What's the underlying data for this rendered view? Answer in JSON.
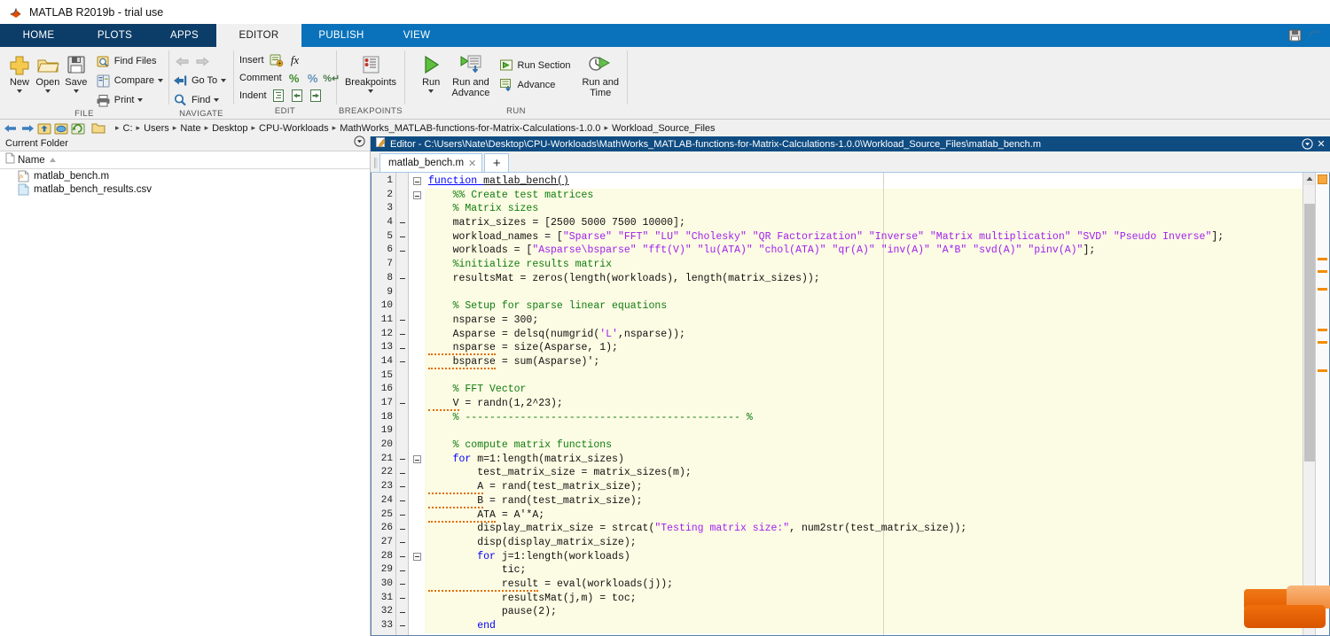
{
  "window": {
    "title": "MATLAB R2019b - trial use",
    "logo_icon": "matlab-logo-icon"
  },
  "ribbon": {
    "tabs": [
      {
        "label": "HOME",
        "active": false
      },
      {
        "label": "PLOTS",
        "active": false
      },
      {
        "label": "APPS",
        "active": false
      },
      {
        "label": "EDITOR",
        "active": true
      },
      {
        "label": "PUBLISH",
        "active": false
      },
      {
        "label": "VIEW",
        "active": false
      }
    ],
    "quick_access": [
      "save-icon",
      "undo-icon"
    ],
    "groups": [
      {
        "name": "FILE",
        "big_buttons": [
          {
            "label": "New",
            "icon": "new-plus-icon",
            "has_caret": true
          },
          {
            "label": "Open",
            "icon": "open-folder-icon",
            "has_caret": true
          },
          {
            "label": "Save",
            "icon": "save-disk-icon",
            "has_caret": true
          }
        ],
        "small_buttons": [
          {
            "label": "Find Files",
            "icon": "find-files-icon",
            "has_caret": false
          },
          {
            "label": "Compare",
            "icon": "compare-icon",
            "has_caret": true
          },
          {
            "label": "Print",
            "icon": "print-icon",
            "has_caret": true
          }
        ]
      },
      {
        "name": "NAVIGATE",
        "arrows": [
          "back-arrow-icon",
          "forward-arrow-icon"
        ],
        "small_buttons": [
          {
            "label": "Go To",
            "icon": "goto-icon",
            "has_caret": true
          },
          {
            "label": "Find",
            "icon": "find-magnifier-icon",
            "has_caret": true
          }
        ]
      },
      {
        "name": "EDIT",
        "rows": [
          {
            "label": "Insert",
            "icons": [
              "insert-icon",
              "fx-function-icon"
            ]
          },
          {
            "label": "Comment",
            "icons": [
              "comment-percent-icon",
              "uncomment-percent-icon",
              "wrap-comment-icon"
            ]
          },
          {
            "label": "Indent",
            "icons": [
              "smart-indent-icon",
              "indent-right-icon",
              "indent-left-icon"
            ]
          }
        ]
      },
      {
        "name": "BREAKPOINTS",
        "big_buttons": [
          {
            "label": "Breakpoints",
            "icon": "breakpoints-icon",
            "has_caret": true
          }
        ]
      },
      {
        "name": "RUN",
        "big_buttons": [
          {
            "label": "Run",
            "icon": "run-play-icon",
            "has_caret": true
          },
          {
            "label": "Run and Advance",
            "icon": "run-advance-icon",
            "has_caret": false
          },
          {
            "label": "Run and Time",
            "icon": "run-time-icon",
            "has_caret": false
          }
        ],
        "small_buttons": [
          {
            "label": "Run Section",
            "icon": "run-section-icon",
            "has_caret": false
          },
          {
            "label": "Advance",
            "icon": "advance-icon",
            "has_caret": false
          }
        ]
      }
    ]
  },
  "addressbar": {
    "nav_icons": [
      "back-arrow-icon",
      "forward-arrow-icon",
      "up-folder-icon",
      "browse-folder-icon",
      "refresh-icon"
    ],
    "folder_icon": "folder-icon",
    "crumbs": [
      "C:",
      "Users",
      "Nate",
      "Desktop",
      "CPU-Workloads",
      "MathWorks_MATLAB-functions-for-Matrix-Calculations-1.0.0",
      "Workload_Source_Files"
    ],
    "separator": "▸"
  },
  "current_folder": {
    "title": "Current Folder",
    "actions_icon": "panel-actions-icon",
    "column_header": {
      "label": "Name",
      "sort_icon": "sort-ascending-icon",
      "file_icon": "file-column-icon"
    },
    "files": [
      {
        "name": "matlab_bench.m",
        "icon": "m-file-icon"
      },
      {
        "name": "matlab_bench_results.csv",
        "icon": "csv-file-icon"
      }
    ]
  },
  "editor": {
    "title": "Editor - C:\\Users\\Nate\\Desktop\\CPU-Workloads\\MathWorks_MATLAB-functions-for-Matrix-Calculations-1.0.0\\Workload_Source_Files\\matlab_bench.m",
    "title_icon": "editor-doc-icon",
    "minimize_icon": "panel-actions-icon",
    "close_icon": "close-icon",
    "tabs": [
      {
        "label": "matlab_bench.m",
        "active": true,
        "close_icon": "close-icon"
      }
    ],
    "new_tab_label": "+",
    "scrollbar": {
      "thumb_top_pct": 4,
      "thumb_height_pct": 56
    },
    "markers": [
      96,
      110,
      130,
      176,
      190,
      222
    ],
    "lines": [
      {
        "n": 1,
        "bp": false,
        "fold": "open",
        "code": [
          {
            "t": "function ",
            "c": "kw-ul"
          },
          {
            "t": "matlab_bench()",
            "c": "ul"
          }
        ]
      },
      {
        "n": 2,
        "bp": false,
        "fold": "open2",
        "code": [
          {
            "t": "    %% Create test matrices",
            "c": "cm"
          }
        ]
      },
      {
        "n": 3,
        "bp": false,
        "fold": "tick",
        "code": [
          {
            "t": "    % Matrix sizes",
            "c": "cm"
          }
        ]
      },
      {
        "n": 4,
        "bp": true,
        "fold": "",
        "code": [
          {
            "t": "    matrix_sizes = [2500 5000 7500 10000];",
            "c": ""
          }
        ]
      },
      {
        "n": 5,
        "bp": true,
        "fold": "",
        "code": [
          {
            "t": "    workload_names = [",
            "c": ""
          },
          {
            "t": "\"Sparse\" \"FFT\" \"LU\" \"Cholesky\" \"QR Factorization\" \"Inverse\" \"Matrix multiplication\" \"SVD\" \"Pseudo Inverse\"",
            "c": "st"
          },
          {
            "t": "];",
            "c": ""
          }
        ]
      },
      {
        "n": 6,
        "bp": true,
        "fold": "",
        "code": [
          {
            "t": "    workloads = [",
            "c": ""
          },
          {
            "t": "\"Asparse\\bsparse\" \"fft(V)\" \"lu(ATA)\" \"chol(ATA)\" \"qr(A)\" \"inv(A)\" \"A*B\" \"svd(A)\" \"pinv(A)\"",
            "c": "st"
          },
          {
            "t": "];",
            "c": ""
          }
        ]
      },
      {
        "n": 7,
        "bp": false,
        "fold": "",
        "code": [
          {
            "t": "    %initialize results matrix",
            "c": "cm"
          }
        ]
      },
      {
        "n": 8,
        "bp": true,
        "fold": "",
        "code": [
          {
            "t": "    resultsMat = zeros(length(workloads), length(matrix_sizes));",
            "c": ""
          }
        ]
      },
      {
        "n": 9,
        "bp": false,
        "fold": "",
        "code": [
          {
            "t": "",
            "c": ""
          }
        ]
      },
      {
        "n": 10,
        "bp": false,
        "fold": "",
        "code": [
          {
            "t": "    % Setup for sparse linear equations",
            "c": "cm"
          }
        ]
      },
      {
        "n": 11,
        "bp": true,
        "fold": "",
        "code": [
          {
            "t": "    nsparse = 300;",
            "c": ""
          }
        ]
      },
      {
        "n": 12,
        "bp": true,
        "fold": "",
        "code": [
          {
            "t": "    Asparse = delsq(numgrid(",
            "c": ""
          },
          {
            "t": "'L'",
            "c": "sq"
          },
          {
            "t": ",nsparse));",
            "c": ""
          }
        ]
      },
      {
        "n": 13,
        "bp": true,
        "fold": "",
        "code": [
          {
            "t": "    nsparse",
            "c": "sqw"
          },
          {
            "t": " = size(Asparse, 1);",
            "c": ""
          }
        ]
      },
      {
        "n": 14,
        "bp": true,
        "fold": "",
        "code": [
          {
            "t": "    bsparse",
            "c": "sqw"
          },
          {
            "t": " = sum(Asparse)';",
            "c": ""
          }
        ]
      },
      {
        "n": 15,
        "bp": false,
        "fold": "",
        "code": [
          {
            "t": "",
            "c": ""
          }
        ]
      },
      {
        "n": 16,
        "bp": false,
        "fold": "",
        "code": [
          {
            "t": "    % FFT Vector",
            "c": "cm"
          }
        ]
      },
      {
        "n": 17,
        "bp": true,
        "fold": "",
        "code": [
          {
            "t": "    V",
            "c": "sqw"
          },
          {
            "t": " = randn(1,2^23);",
            "c": ""
          }
        ]
      },
      {
        "n": 18,
        "bp": false,
        "fold": "",
        "code": [
          {
            "t": "    % --------------------------------------------- %",
            "c": "cm"
          }
        ]
      },
      {
        "n": 19,
        "bp": false,
        "fold": "",
        "code": [
          {
            "t": "",
            "c": ""
          }
        ]
      },
      {
        "n": 20,
        "bp": false,
        "fold": "",
        "code": [
          {
            "t": "    % compute matrix functions",
            "c": "cm"
          }
        ]
      },
      {
        "n": 21,
        "bp": true,
        "fold": "open2",
        "code": [
          {
            "t": "    for",
            "c": "kw"
          },
          {
            "t": " m=1:length(matrix_sizes)",
            "c": ""
          }
        ]
      },
      {
        "n": 22,
        "bp": true,
        "fold": "",
        "code": [
          {
            "t": "        test_matrix_size = matrix_sizes(m);",
            "c": ""
          }
        ]
      },
      {
        "n": 23,
        "bp": true,
        "fold": "",
        "code": [
          {
            "t": "        A",
            "c": "sqw"
          },
          {
            "t": " = rand(test_matrix_size);",
            "c": ""
          }
        ]
      },
      {
        "n": 24,
        "bp": true,
        "fold": "",
        "code": [
          {
            "t": "        B",
            "c": "sqw"
          },
          {
            "t": " = rand(test_matrix_size);",
            "c": ""
          }
        ]
      },
      {
        "n": 25,
        "bp": true,
        "fold": "",
        "code": [
          {
            "t": "        ATA",
            "c": "sqw"
          },
          {
            "t": " = A'*A;",
            "c": ""
          }
        ]
      },
      {
        "n": 26,
        "bp": true,
        "fold": "",
        "code": [
          {
            "t": "        display_matrix_size = strcat(",
            "c": ""
          },
          {
            "t": "\"Testing matrix size:\"",
            "c": "st"
          },
          {
            "t": ", num2str(test_matrix_size));",
            "c": ""
          }
        ]
      },
      {
        "n": 27,
        "bp": true,
        "fold": "",
        "code": [
          {
            "t": "        disp(display_matrix_size);",
            "c": ""
          }
        ]
      },
      {
        "n": 28,
        "bp": true,
        "fold": "open2",
        "code": [
          {
            "t": "        for",
            "c": "kw"
          },
          {
            "t": " j=1:length(workloads)",
            "c": ""
          }
        ]
      },
      {
        "n": 29,
        "bp": true,
        "fold": "",
        "code": [
          {
            "t": "            tic;",
            "c": ""
          }
        ]
      },
      {
        "n": 30,
        "bp": true,
        "fold": "",
        "code": [
          {
            "t": "            result",
            "c": "sqw"
          },
          {
            "t": " = eval(workloads(j));",
            "c": ""
          }
        ]
      },
      {
        "n": 31,
        "bp": true,
        "fold": "",
        "code": [
          {
            "t": "            resultsMat(j,m) = toc;",
            "c": ""
          }
        ]
      },
      {
        "n": 32,
        "bp": true,
        "fold": "",
        "code": [
          {
            "t": "            pause(2);",
            "c": ""
          }
        ]
      },
      {
        "n": 33,
        "bp": true,
        "fold": "tick",
        "code": [
          {
            "t": "        end",
            "c": "kw"
          }
        ]
      }
    ]
  },
  "colors": {
    "ribbon_dark": "#0c3d68",
    "ribbon_blue": "#0a72ba",
    "panel_bg": "#f0f0f0",
    "code_highlight": "#fcfbe3",
    "keyword": "#0000ff",
    "comment": "#107d10",
    "string": "#a020f0",
    "marker_orange": "#f28c00"
  }
}
